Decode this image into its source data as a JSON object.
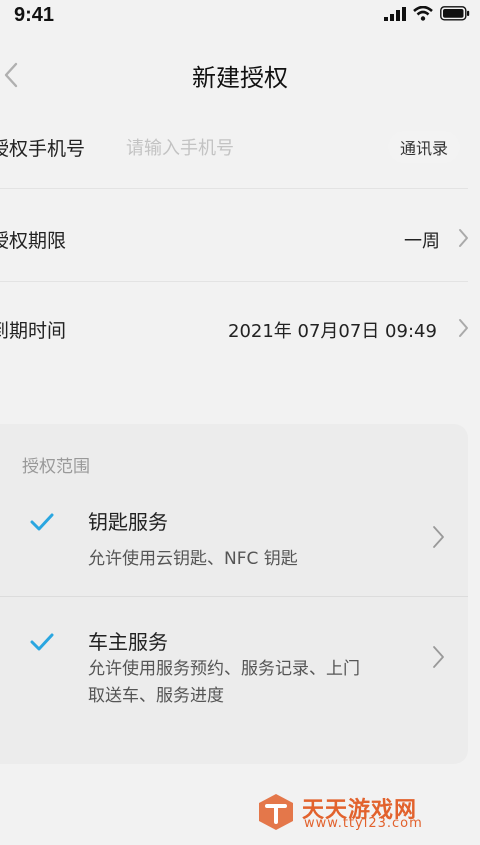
{
  "status_bar": {
    "time": "9:41"
  },
  "nav": {
    "title": "新建授权"
  },
  "form": {
    "phone_label": "授权手机号",
    "phone_placeholder": "请输入手机号",
    "contacts_button": "通讯录",
    "period_label": "授权期限",
    "period_value": "一周",
    "expire_label": "到期时间",
    "expire_value": "2021年 07月07日 09:49"
  },
  "scope": {
    "title": "授权范围",
    "items": [
      {
        "title": "钥匙服务",
        "desc": "允许使用云钥匙、NFC 钥匙",
        "checked": true
      },
      {
        "title": "车主服务",
        "desc_line1": "允许使用服务预约、服务记录、上门",
        "desc_line2": "取送车、服务进度",
        "checked": true
      }
    ]
  },
  "watermark": {
    "name": "天天游戏网",
    "url": "www.ttyl23.com"
  },
  "colors": {
    "accent": "#2aa6e0",
    "watermark": "#e2622d"
  }
}
